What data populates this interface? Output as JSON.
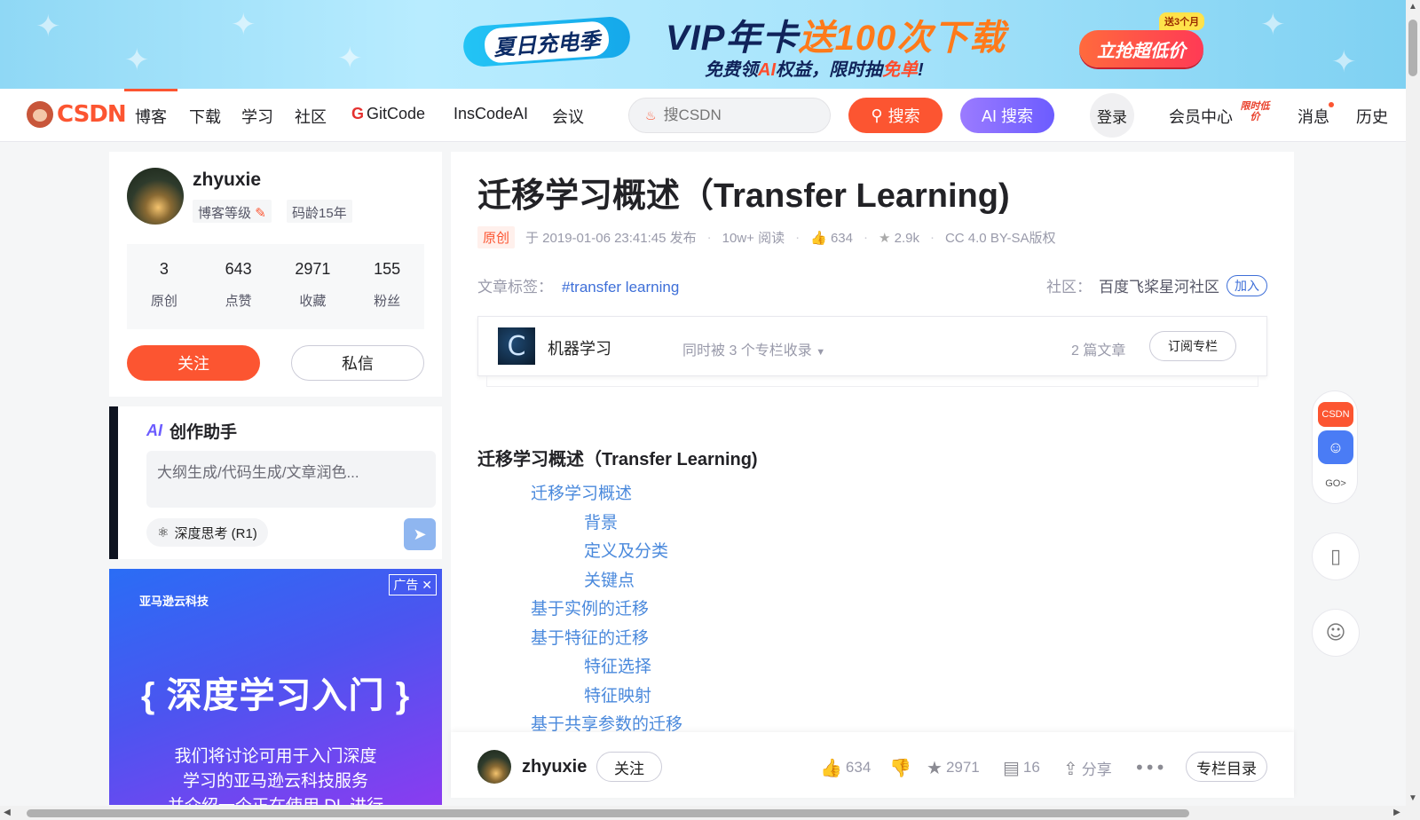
{
  "banner": {
    "summer": "夏日充电季",
    "vip_prefix": "VIP年卡",
    "vip_highlight": "送100次下载",
    "sub_prefix": "免费领",
    "sub_highlight1": "AI",
    "sub_mid": "权益，限时抽",
    "sub_highlight2": "免单",
    "sub_end": "!",
    "buy_label": "立抢超低价",
    "buy_tag": "送3个月"
  },
  "nav": {
    "logo": "CSDN",
    "items": [
      "博客",
      "下载",
      "学习",
      "社区",
      "GitCode",
      "InsCodeAI",
      "会议"
    ],
    "search_placeholder": "搜CSDN",
    "search_button": "搜索",
    "ai_search_button": "AI 搜索",
    "login": "登录",
    "vip_center": "会员中心",
    "vip_badge": "限时低价",
    "messages": "消息",
    "history": "历史"
  },
  "profile": {
    "username": "zhyuxie",
    "level_label": "博客等级",
    "code_age": "码龄15年",
    "stats": [
      {
        "num": "3",
        "label": "原创"
      },
      {
        "num": "643",
        "label": "点赞"
      },
      {
        "num": "2971",
        "label": "收藏"
      },
      {
        "num": "155",
        "label": "粉丝"
      }
    ],
    "follow": "关注",
    "message": "私信"
  },
  "assistant": {
    "title": "创作助手",
    "placeholder": "大纲生成/代码生成/文章润色...",
    "deep_think": "深度思考 (R1)"
  },
  "ad": {
    "brand": "亚马逊云科技",
    "ad_tag": "广告",
    "headline": "深度学习入门",
    "desc_line1": "我们将讨论可用于入门深度",
    "desc_line2": "学习的亚马逊云科技服务",
    "desc_line3": "并介绍一个正在使用 DL 进行"
  },
  "article": {
    "title": "迁移学习概述（Transfer Learning)",
    "original": "原创",
    "published": "于 2019-01-06 23:41:45 发布",
    "reads": "10w+ 阅读",
    "likes": "634",
    "favorites": "2.9k",
    "license": "CC 4.0 BY-SA版权",
    "tags_label": "文章标签：",
    "tag": "#transfer learning",
    "community_label": "社区：",
    "community": "百度飞桨星河社区",
    "join": "加入",
    "column": {
      "icon_letter": "C",
      "name": "机器学习",
      "multi": "同时被 3 个专栏收录",
      "count": "2 篇文章",
      "subscribe": "订阅专栏"
    },
    "toc_title": "迁移学习概述（Transfer Learning)",
    "toc": [
      {
        "level": 1,
        "text": "迁移学习概述"
      },
      {
        "level": 2,
        "text": "背景"
      },
      {
        "level": 2,
        "text": "定义及分类"
      },
      {
        "level": 2,
        "text": "关键点"
      },
      {
        "level": 1,
        "text": "基于实例的迁移"
      },
      {
        "level": 1,
        "text": "基于特征的迁移"
      },
      {
        "level": 2,
        "text": "特征选择"
      },
      {
        "level": 2,
        "text": "特征映射"
      },
      {
        "level": 1,
        "text": "基于共享参数的迁移"
      }
    ]
  },
  "toolbar": {
    "username": "zhyuxie",
    "follow": "关注",
    "likes": "634",
    "favorites": "2971",
    "comments": "16",
    "share": "分享",
    "column_toc": "专栏目录"
  },
  "float": {
    "csdn": "CSDN",
    "go": "GO>"
  }
}
